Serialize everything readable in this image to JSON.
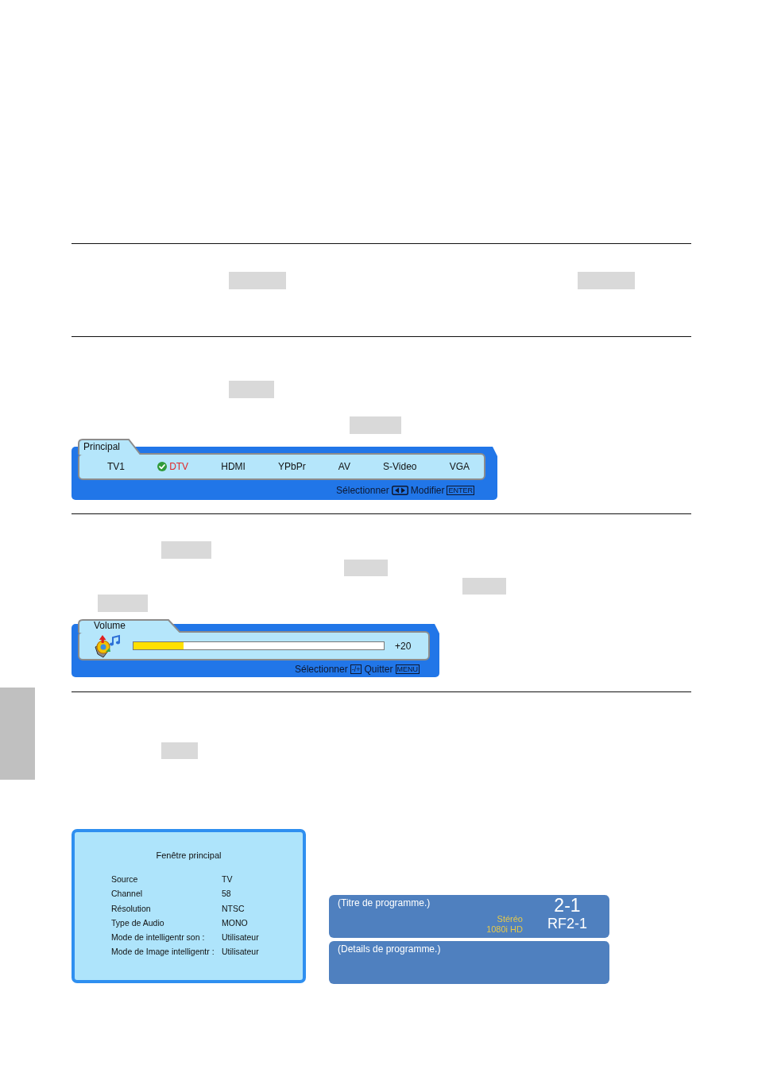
{
  "source_menu": {
    "title": "Principal",
    "items": [
      {
        "label": "TV1",
        "selected": false
      },
      {
        "label": "DTV",
        "selected": true
      },
      {
        "label": "HDMI",
        "selected": false
      },
      {
        "label": "YPbPr",
        "selected": false
      },
      {
        "label": "AV",
        "selected": false
      },
      {
        "label": "S-Video",
        "selected": false
      },
      {
        "label": "VGA",
        "selected": false
      }
    ],
    "hints": [
      {
        "kind": "text",
        "text": "Sélectionner"
      },
      {
        "kind": "arrow_keys"
      },
      {
        "kind": "text",
        "text": "Modifier"
      },
      {
        "kind": "key",
        "text": "ENTER"
      }
    ]
  },
  "volume": {
    "title": "Volume",
    "level": 0.2,
    "reading": "+20",
    "hints": [
      {
        "kind": "text",
        "text": "Sélectionner"
      },
      {
        "kind": "key",
        "text": "-/+"
      },
      {
        "kind": "text",
        "text": "Quitter"
      },
      {
        "kind": "key",
        "text": "MENU"
      }
    ]
  },
  "info_window": {
    "title": "Fenêtre principal",
    "rows": [
      {
        "label": "Source",
        "value": "TV"
      },
      {
        "label": "Channel",
        "value": "58"
      },
      {
        "label": "Résolution",
        "value": "NTSC"
      },
      {
        "label": "Type de Audio",
        "value": "MONO"
      },
      {
        "label": "Mode de intelligentr son :",
        "value": "Utilisateur"
      },
      {
        "label": "Mode de Image intelligentr :",
        "value": "Utilisateur"
      }
    ]
  },
  "program_banner": {
    "title": "(Titre de programme.)",
    "audio": "Stéréo",
    "resolution": "1080i HD",
    "channel_number": "2-1",
    "channel_name": "RF2-1",
    "details": "(Details de programme.)"
  }
}
